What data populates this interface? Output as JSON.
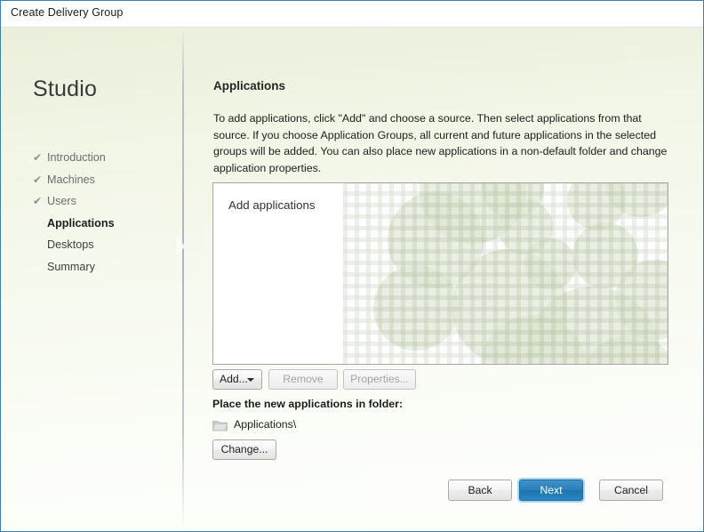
{
  "window": {
    "title": "Create Delivery Group",
    "accent_border": "#3c7fb1"
  },
  "sidebar": {
    "product_title": "Studio",
    "items": [
      {
        "label": "Introduction",
        "state": "done",
        "icon": "check-icon",
        "check": "✔"
      },
      {
        "label": "Machines",
        "state": "done",
        "icon": "check-icon",
        "check": "✔"
      },
      {
        "label": "Users",
        "state": "done",
        "icon": "check-icon",
        "check": "✔"
      },
      {
        "label": "Applications",
        "state": "current",
        "icon": "",
        "check": ""
      },
      {
        "label": "Desktops",
        "state": "pending",
        "icon": "",
        "check": ""
      },
      {
        "label": "Summary",
        "state": "pending",
        "icon": "",
        "check": ""
      }
    ]
  },
  "content": {
    "heading": "Applications",
    "description": "To add applications, click \"Add\" and choose a source. Then select applications from that source. If you choose Application Groups, all current and future applications in the selected groups will be added. You can also place new applications in a non-default folder and change application properties.",
    "list_panel": {
      "label": "Add applications",
      "items": [],
      "watermark_color": "#dde5d2"
    },
    "list_buttons": {
      "add": "Add...",
      "remove": "Remove",
      "properties": "Properties..."
    },
    "folder_section": {
      "label": "Place the new applications in folder:",
      "folder_icon": "folder-icon",
      "folder_path": "Applications\\",
      "change_button": "Change..."
    }
  },
  "footer": {
    "back": "Back",
    "next": "Next",
    "cancel": "Cancel",
    "primary_color": "#2a7fb8"
  }
}
